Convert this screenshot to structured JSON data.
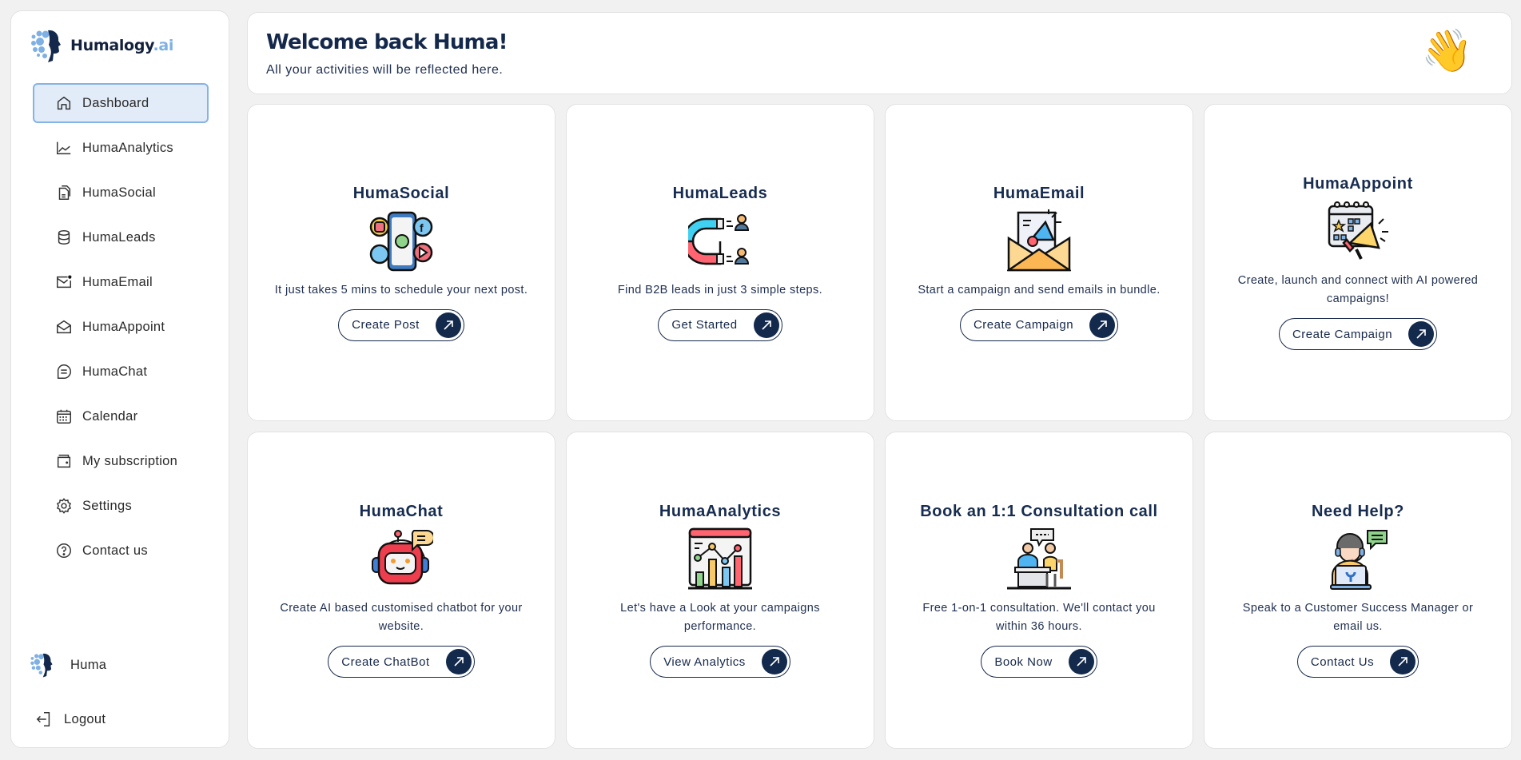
{
  "brand": {
    "name": "Humalogy",
    "suffix": ".ai"
  },
  "sidebar": {
    "items": [
      {
        "label": "Dashboard",
        "icon": "home-icon",
        "active": true
      },
      {
        "label": "HumaAnalytics",
        "icon": "chart-line-icon"
      },
      {
        "label": "HumaSocial",
        "icon": "documents-icon"
      },
      {
        "label": "HumaLeads",
        "icon": "database-icon"
      },
      {
        "label": "HumaEmail",
        "icon": "mail-notification-icon"
      },
      {
        "label": "HumaAppoint",
        "icon": "mail-open-icon"
      },
      {
        "label": "HumaChat",
        "icon": "chat-bubble-icon"
      },
      {
        "label": "Calendar",
        "icon": "calendar-icon"
      },
      {
        "label": "My subscription",
        "icon": "wallet-icon"
      },
      {
        "label": "Settings",
        "icon": "gear-icon"
      },
      {
        "label": "Contact us",
        "icon": "help-circle-icon"
      }
    ],
    "user": {
      "name": "Huma"
    },
    "logout_label": "Logout"
  },
  "header": {
    "title": "Welcome back Huma!",
    "subtitle": "All your activities will be reflected here.",
    "emoji": "👋"
  },
  "cards": [
    {
      "title": "HumaSocial",
      "icon": "social-phone-icon",
      "description": "It just takes 5 mins to schedule your next post.",
      "button": "Create Post"
    },
    {
      "title": "HumaLeads",
      "icon": "magnet-leads-icon",
      "description": "Find B2B leads in just 3 simple steps.",
      "button": "Get Started"
    },
    {
      "title": "HumaEmail",
      "icon": "email-megaphone-icon",
      "description": "Start a campaign and send emails in bundle.",
      "button": "Create Campaign"
    },
    {
      "title": "HumaAppoint",
      "icon": "calendar-megaphone-icon",
      "description": "Create, launch and connect with AI powered campaigns!",
      "button": "Create Campaign"
    },
    {
      "title": "HumaChat",
      "icon": "chatbot-icon",
      "description": "Create AI based customised chatbot for your website.",
      "button": "Create ChatBot"
    },
    {
      "title": "HumaAnalytics",
      "icon": "analytics-dashboard-icon",
      "description": "Let's have a Look at your campaigns performance.",
      "button": "View Analytics"
    },
    {
      "title": "Book an 1:1 Consultation call",
      "icon": "consultation-icon",
      "description": "Free 1-on-1 consultation. We'll contact you within 36 hours.",
      "button": "Book Now"
    },
    {
      "title": "Need Help?",
      "icon": "support-agent-icon",
      "description": "Speak to a Customer Success Manager or email us.",
      "button": "Contact Us"
    }
  ],
  "colors": {
    "accent": "#132a4d",
    "active_bg": "#e2ecf8",
    "active_border": "#86b3e5",
    "brand_light": "#7fb0e3"
  }
}
